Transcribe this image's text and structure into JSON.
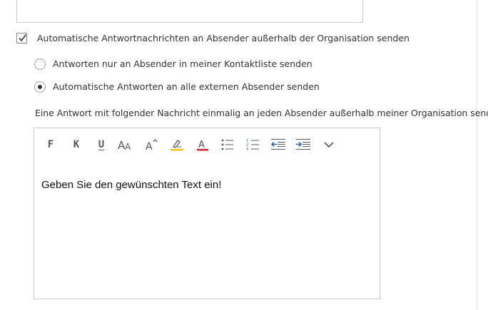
{
  "auto_reply_external": {
    "checkbox_label": "Automatische Antwortnachrichten an Absender außerhalb der Organisation senden",
    "checked": true,
    "options": [
      {
        "label": "Antworten nur an Absender in meiner Kontaktliste senden",
        "selected": false
      },
      {
        "label": "Automatische Antworten an alle externen Absender senden",
        "selected": true
      }
    ],
    "message_description": "Eine Antwort mit folgender Nachricht einmalig an jeden Absender außerhalb meiner Organisation senden:"
  },
  "editor": {
    "toolbar": {
      "bold_label": "F",
      "italic_label": "K",
      "underline_label": "U",
      "icons": [
        "font-size-icon",
        "grow-font-icon",
        "highlight-icon",
        "font-color-icon",
        "bullet-list-icon",
        "numbered-list-icon",
        "outdent-icon",
        "indent-icon",
        "more-chevron-icon"
      ],
      "highlight_color": "#f5c400",
      "font_color": "#d9262c",
      "accent_color": "#1f5fa8"
    },
    "body_text": "Geben Sie den gewünschten Text ein!"
  }
}
